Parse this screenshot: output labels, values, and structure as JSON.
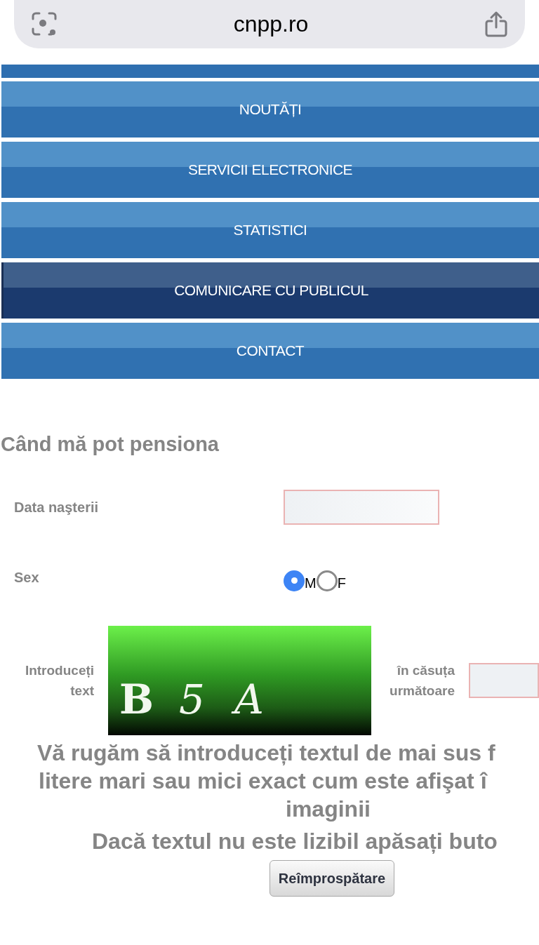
{
  "address_bar": {
    "url": "cnpp.ro"
  },
  "nav_menu": [
    {
      "label": "NOUTĂȚI",
      "selected": false
    },
    {
      "label": "SERVICII ELECTRONICE",
      "selected": false
    },
    {
      "label": "STATISTICI",
      "selected": false
    },
    {
      "label": "COMUNICARE CU PUBLICUL",
      "selected": true
    },
    {
      "label": "CONTACT",
      "selected": false
    }
  ],
  "title": "Când mă pot pensiona",
  "form": {
    "birth_date_label": "Data naşterii",
    "sex_label": "Sex",
    "sex_options": [
      {
        "label": "M",
        "selected": true
      },
      {
        "label": "F",
        "selected": false
      }
    ]
  },
  "captcha": {
    "label_before": [
      "Introduceți",
      "text"
    ],
    "characters": [
      "B",
      "5",
      "A"
    ],
    "label_after": [
      "în căsuța",
      "următoare"
    ]
  },
  "instructions": [
    "Vă rugăm să introduceți textul de mai sus f",
    "litere mari sau mici exact cum este afişat î",
    "imaginii",
    "Dacă textul nu este lizibil apăsați buto"
  ],
  "refresh_button": "Reîmprospătare"
}
